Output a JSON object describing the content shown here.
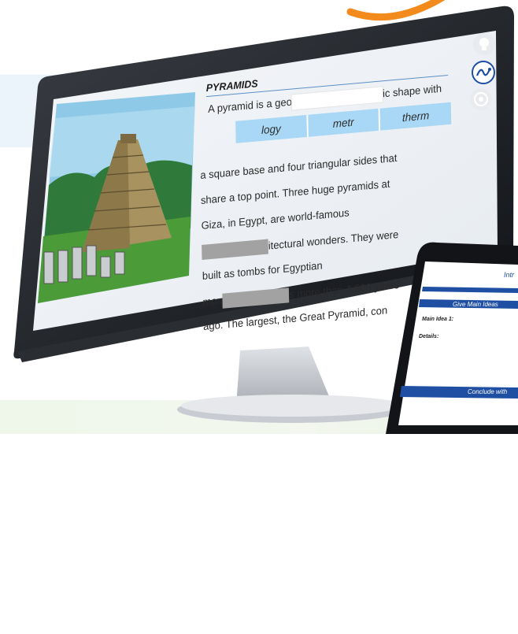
{
  "lesson": {
    "title": "PYRAMIDS",
    "line1_pre": "A pyramid is a geo",
    "line1_post": "ic shape with",
    "choices": [
      "logy",
      "metr",
      "therm"
    ],
    "line2": "a square base and four triangular sides that",
    "line3": "share a top point. Three huge pyramids at",
    "line4": "Giza, in Egypt, are world-famous",
    "line5_post": "itectural wonders. They were",
    "line6": "built as tombs for Egyptian",
    "line7_pre": "mon",
    "line7_post": "s more than 4,500 years",
    "line8": "ago. The largest, the Great Pyramid, con"
  },
  "side_icons": [
    "lightbulb-icon",
    "wave-chart-icon",
    "target-icon"
  ],
  "tablet": {
    "header": "Intr",
    "section_bar": "Give Main Ideas",
    "main_idea_label": "Main Idea 1:",
    "details_label": "Details:",
    "footer_bar": "Conclude with"
  },
  "colors": {
    "choice_bg": "#a8d8f5",
    "accent_blue": "#1f4fa3",
    "orange": "#f28a1c",
    "blank_gray": "#a2a2a2"
  }
}
